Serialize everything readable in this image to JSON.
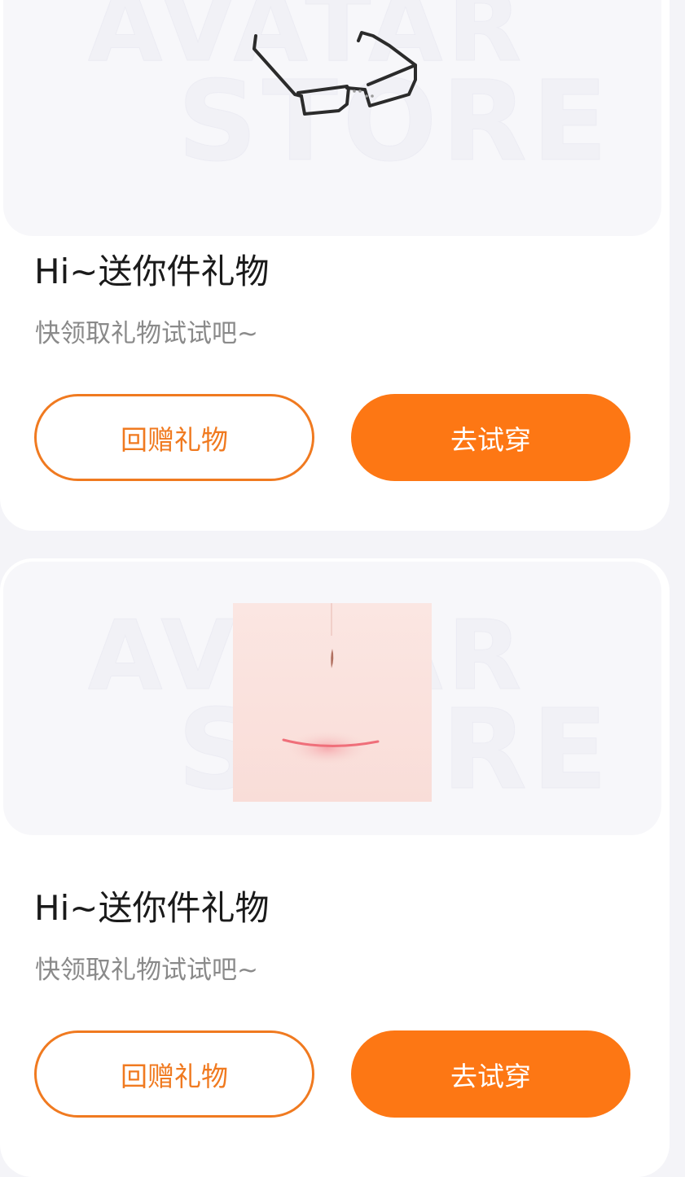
{
  "watermark": {
    "line1": "AVATAR",
    "line2": "STORE"
  },
  "gifts": [
    {
      "item_icon": "glasses-icon",
      "title": "Hi~送你件礼物",
      "subtitle": "快领取礼物试试吧~",
      "return_gift_label": "回赠礼物",
      "try_on_label": "去试穿"
    },
    {
      "item_icon": "face-makeup-icon",
      "title": "Hi~送你件礼物",
      "subtitle": "快领取礼物试试吧~",
      "return_gift_label": "回赠礼物",
      "try_on_label": "去试穿"
    }
  ],
  "colors": {
    "accent": "#fd7714",
    "outline_accent": "#f07a20",
    "title_text": "#1a1a1a",
    "subtitle_text": "#8a8a8a",
    "page_background": "#f4f4f8"
  }
}
